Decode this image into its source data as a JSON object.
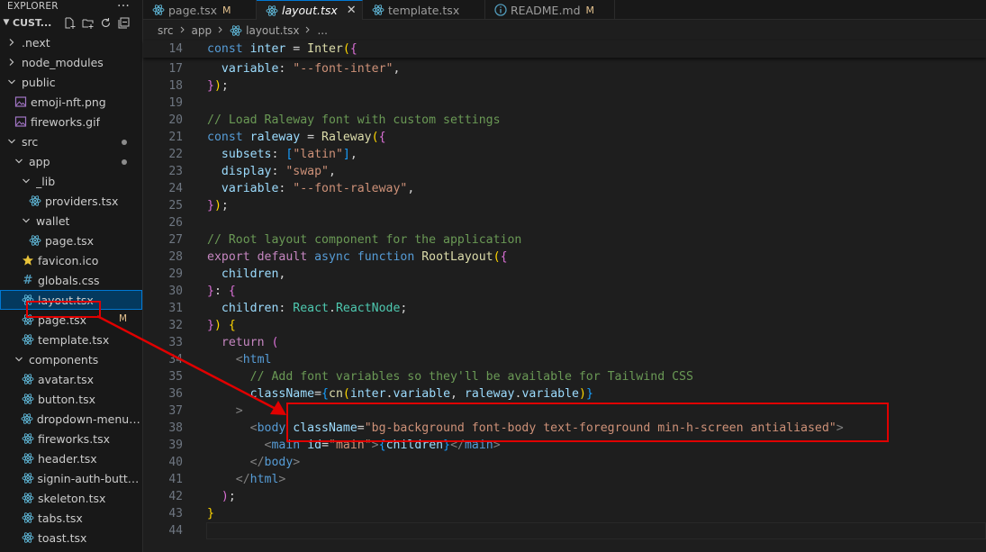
{
  "sidebar": {
    "header": "EXPLORER",
    "more": "···",
    "section_title": "CUST...",
    "tree": [
      {
        "label": ".next",
        "kind": "folder-closed",
        "depth": 0
      },
      {
        "label": "node_modules",
        "kind": "folder-closed",
        "depth": 0
      },
      {
        "label": "public",
        "kind": "folder-open",
        "depth": 0
      },
      {
        "label": "emoji-nft.png",
        "kind": "image",
        "depth": 1
      },
      {
        "label": "fireworks.gif",
        "kind": "image",
        "depth": 1
      },
      {
        "label": "src",
        "kind": "folder-open",
        "depth": 0,
        "dot": true
      },
      {
        "label": "app",
        "kind": "folder-open",
        "depth": 1,
        "dot": true
      },
      {
        "label": "_lib",
        "kind": "folder-open",
        "depth": 2
      },
      {
        "label": "providers.tsx",
        "kind": "react",
        "depth": 3
      },
      {
        "label": "wallet",
        "kind": "folder-open",
        "depth": 2
      },
      {
        "label": "page.tsx",
        "kind": "react",
        "depth": 3
      },
      {
        "label": "favicon.ico",
        "kind": "star",
        "depth": 2
      },
      {
        "label": "globals.css",
        "kind": "css",
        "depth": 2
      },
      {
        "label": "layout.tsx",
        "kind": "react",
        "depth": 2,
        "selected": true
      },
      {
        "label": "page.tsx",
        "kind": "react",
        "depth": 2,
        "badge": "M"
      },
      {
        "label": "template.tsx",
        "kind": "react",
        "depth": 2
      },
      {
        "label": "components",
        "kind": "folder-open",
        "depth": 1
      },
      {
        "label": "avatar.tsx",
        "kind": "react",
        "depth": 2
      },
      {
        "label": "button.tsx",
        "kind": "react",
        "depth": 2
      },
      {
        "label": "dropdown-menu.tsx",
        "kind": "react",
        "depth": 2
      },
      {
        "label": "fireworks.tsx",
        "kind": "react",
        "depth": 2
      },
      {
        "label": "header.tsx",
        "kind": "react",
        "depth": 2
      },
      {
        "label": "signin-auth-butto...",
        "kind": "react",
        "depth": 2
      },
      {
        "label": "skeleton.tsx",
        "kind": "react",
        "depth": 2
      },
      {
        "label": "tabs.tsx",
        "kind": "react",
        "depth": 2
      },
      {
        "label": "toast.tsx",
        "kind": "react",
        "depth": 2
      }
    ]
  },
  "tabs": [
    {
      "label": "page.tsx",
      "badge": "M",
      "active": false
    },
    {
      "label": "layout.tsx",
      "badge": "",
      "active": true,
      "close": "✕"
    },
    {
      "label": "template.tsx",
      "badge": "",
      "active": false
    },
    {
      "label": "README.md",
      "badge": "M",
      "active": false,
      "icon": "info"
    }
  ],
  "breadcrumb": [
    "src",
    "app",
    "layout.tsx",
    "..."
  ],
  "editor": {
    "lines": [
      {
        "n": "14",
        "tokens": [
          [
            "kw",
            "const "
          ],
          [
            "var",
            "inter"
          ],
          [
            "p",
            " = "
          ],
          [
            "fn",
            "Inter"
          ],
          [
            "b1",
            "("
          ],
          [
            "b2",
            "{"
          ]
        ]
      },
      {
        "n": "17",
        "tokens": [
          [
            "prop",
            "  variable"
          ],
          [
            "p",
            ": "
          ],
          [
            "str",
            "\"--font-inter\""
          ],
          [
            "p",
            ","
          ]
        ]
      },
      {
        "n": "18",
        "tokens": [
          [
            "b2",
            "}"
          ],
          [
            "b1",
            ")"
          ],
          [
            "p",
            ";"
          ]
        ]
      },
      {
        "n": "19",
        "tokens": []
      },
      {
        "n": "20",
        "tokens": [
          [
            "com",
            "// Load Raleway font with custom settings"
          ]
        ]
      },
      {
        "n": "21",
        "tokens": [
          [
            "kw",
            "const "
          ],
          [
            "var",
            "raleway"
          ],
          [
            "p",
            " = "
          ],
          [
            "fn",
            "Raleway"
          ],
          [
            "b1",
            "("
          ],
          [
            "b2",
            "{"
          ]
        ]
      },
      {
        "n": "22",
        "tokens": [
          [
            "prop",
            "  subsets"
          ],
          [
            "p",
            ": "
          ],
          [
            "b3",
            "["
          ],
          [
            "str",
            "\"latin\""
          ],
          [
            "b3",
            "]"
          ],
          [
            "p",
            ","
          ]
        ]
      },
      {
        "n": "23",
        "tokens": [
          [
            "prop",
            "  display"
          ],
          [
            "p",
            ": "
          ],
          [
            "str",
            "\"swap\""
          ],
          [
            "p",
            ","
          ]
        ]
      },
      {
        "n": "24",
        "tokens": [
          [
            "prop",
            "  variable"
          ],
          [
            "p",
            ": "
          ],
          [
            "str",
            "\"--font-raleway\""
          ],
          [
            "p",
            ","
          ]
        ]
      },
      {
        "n": "25",
        "tokens": [
          [
            "b2",
            "}"
          ],
          [
            "b1",
            ")"
          ],
          [
            "p",
            ";"
          ]
        ]
      },
      {
        "n": "26",
        "tokens": []
      },
      {
        "n": "27",
        "tokens": [
          [
            "com",
            "// Root layout component for the application"
          ]
        ]
      },
      {
        "n": "28",
        "tokens": [
          [
            "kc",
            "export "
          ],
          [
            "kc",
            "default "
          ],
          [
            "kw",
            "async "
          ],
          [
            "kw",
            "function "
          ],
          [
            "fn",
            "RootLayout"
          ],
          [
            "b1",
            "("
          ],
          [
            "b2",
            "{"
          ]
        ]
      },
      {
        "n": "29",
        "tokens": [
          [
            "var",
            "  children"
          ],
          [
            "p",
            ","
          ]
        ]
      },
      {
        "n": "30",
        "tokens": [
          [
            "b2",
            "}"
          ],
          [
            "p",
            ": "
          ],
          [
            "b2",
            "{"
          ]
        ]
      },
      {
        "n": "31",
        "tokens": [
          [
            "prop",
            "  children"
          ],
          [
            "p",
            ": "
          ],
          [
            "type",
            "React"
          ],
          [
            "p",
            "."
          ],
          [
            "type",
            "ReactNode"
          ],
          [
            "p",
            ";"
          ]
        ]
      },
      {
        "n": "32",
        "tokens": [
          [
            "b2",
            "}"
          ],
          [
            "b1",
            ")"
          ],
          [
            "p",
            " "
          ],
          [
            "b1",
            "{"
          ]
        ]
      },
      {
        "n": "33",
        "tokens": [
          [
            "kc",
            "  return "
          ],
          [
            "b2",
            "("
          ]
        ]
      },
      {
        "n": "34",
        "tokens": [
          [
            "ang",
            "    <"
          ],
          [
            "tag",
            "html"
          ]
        ]
      },
      {
        "n": "35",
        "tokens": [
          [
            "com",
            "      // Add font variables so they'll be available for Tailwind CSS"
          ]
        ]
      },
      {
        "n": "36",
        "tokens": [
          [
            "attr",
            "      className"
          ],
          [
            "p",
            "="
          ],
          [
            "b3",
            "{"
          ],
          [
            "fn",
            "cn"
          ],
          [
            "b1",
            "("
          ],
          [
            "var",
            "inter"
          ],
          [
            "p",
            "."
          ],
          [
            "var",
            "variable"
          ],
          [
            "p",
            ", "
          ],
          [
            "var",
            "raleway"
          ],
          [
            "p",
            "."
          ],
          [
            "var",
            "variable"
          ],
          [
            "b1",
            ")"
          ],
          [
            "b3",
            "}"
          ]
        ]
      },
      {
        "n": "37",
        "tokens": [
          [
            "ang",
            "    >"
          ]
        ]
      },
      {
        "n": "38",
        "tokens": [
          [
            "ang",
            "      <"
          ],
          [
            "tag",
            "body"
          ],
          [
            "p",
            " "
          ],
          [
            "attr",
            "className"
          ],
          [
            "p",
            "="
          ],
          [
            "str",
            "\"bg-background font-body text-foreground min-h-screen antialiased\""
          ],
          [
            "ang",
            ">"
          ]
        ]
      },
      {
        "n": "39",
        "tokens": [
          [
            "ang",
            "        <"
          ],
          [
            "tag",
            "main"
          ],
          [
            "p",
            " "
          ],
          [
            "attr",
            "id"
          ],
          [
            "p",
            "="
          ],
          [
            "str",
            "\"main\""
          ],
          [
            "ang",
            ">"
          ],
          [
            "b3",
            "{"
          ],
          [
            "var",
            "children"
          ],
          [
            "b3",
            "}"
          ],
          [
            "ang",
            "</"
          ],
          [
            "tag",
            "main"
          ],
          [
            "ang",
            ">"
          ]
        ]
      },
      {
        "n": "40",
        "tokens": [
          [
            "ang",
            "      </"
          ],
          [
            "tag",
            "body"
          ],
          [
            "ang",
            ">"
          ]
        ]
      },
      {
        "n": "41",
        "tokens": [
          [
            "ang",
            "    </"
          ],
          [
            "tag",
            "html"
          ],
          [
            "ang",
            ">"
          ]
        ]
      },
      {
        "n": "42",
        "tokens": [
          [
            "b2",
            "  )"
          ],
          [
            "p",
            ";"
          ]
        ]
      },
      {
        "n": "43",
        "tokens": [
          [
            "b1",
            "}"
          ]
        ]
      },
      {
        "n": "44",
        "tokens": []
      }
    ]
  },
  "colors": {
    "annotation": "#e00000",
    "accent": "#0078d4",
    "modified_badge": "#e2c08d"
  }
}
